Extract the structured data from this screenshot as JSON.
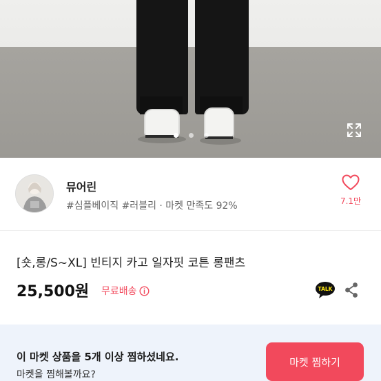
{
  "gallery": {
    "slide_count": 3,
    "active_slide": 1,
    "expand_icon": "expand-icon"
  },
  "seller": {
    "name": "뮤어린",
    "meta": "#심플베이직 #러블리 · 마켓 만족도 92%",
    "like_icon": "heart-icon",
    "like_count": "7.1만"
  },
  "product": {
    "title": "[숏,롱/S~XL] 빈티지 카고 일자핏 코튼 롱팬츠",
    "price": "25,500원",
    "shipping": "무료배송",
    "shipping_icon": "info-icon",
    "talk_label": "TALK",
    "share_icon": "share-icon"
  },
  "banner": {
    "main_text": "이 마켓 상품을 5개 이상 찜하셨네요.",
    "sub_text": "마켓을 찜해볼까요?",
    "cta_label": "마켓 찜하기"
  },
  "colors": {
    "accent": "#f2495c",
    "banner_bg": "#eef3fb"
  }
}
